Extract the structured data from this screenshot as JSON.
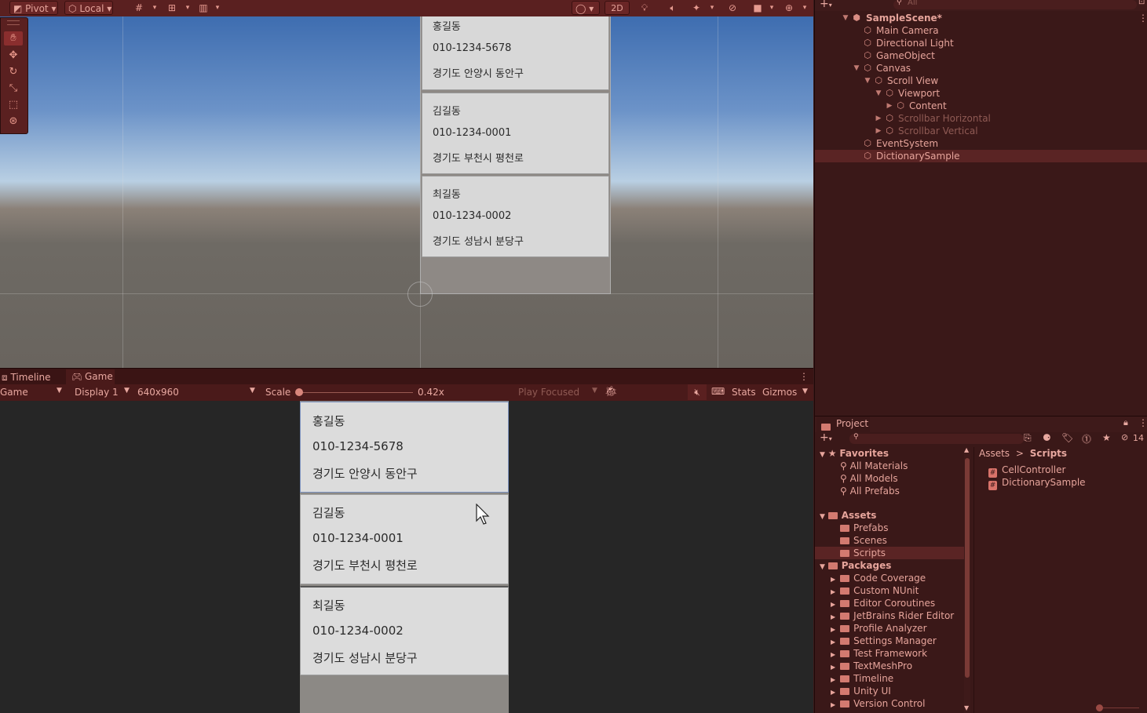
{
  "scene_toolbar": {
    "pivot_label": "Pivot",
    "local_label": "Local",
    "mode_2d_label": "2D"
  },
  "scene_cards": [
    {
      "name": "홍길동",
      "phone": "010-1234-5678",
      "address": "경기도 안양시 동안구"
    },
    {
      "name": "김길동",
      "phone": "010-1234-0001",
      "address": "경기도 부천시 평천로"
    },
    {
      "name": "최길동",
      "phone": "010-1234-0002",
      "address": "경기도 성남시 분당구"
    }
  ],
  "game_tabs": {
    "timeline_label": "Timeline",
    "game_label": "Game"
  },
  "game_toolbar": {
    "view_select": "Game",
    "display_select": "Display 1",
    "resolution_select": "640x960",
    "scale_label": "Scale",
    "scale_value_text": "0.42x",
    "play_focused_label": "Play Focused",
    "stats_label": "Stats",
    "gizmos_label": "Gizmos"
  },
  "game_cards": [
    {
      "name": "홍길동",
      "phone": "010-1234-5678",
      "address": "경기도 안양시 동안구"
    },
    {
      "name": "김길동",
      "phone": "010-1234-0001",
      "address": "경기도 부천시 평천로"
    },
    {
      "name": "최길동",
      "phone": "010-1234-0002",
      "address": "경기도 성남시 분당구"
    }
  ],
  "hierarchy": {
    "search_placeholder": "All",
    "scene_name": "SampleScene*",
    "items": [
      "Main Camera",
      "Directional Light",
      "GameObject",
      "Canvas",
      "Scroll View",
      "Viewport",
      "Content",
      "Scrollbar Horizontal",
      "Scrollbar Vertical",
      "EventSystem",
      "DictionarySample"
    ]
  },
  "project": {
    "tab_label": "Project",
    "hidden_count": "14",
    "breadcrumb_root": "Assets",
    "breadcrumb_sep": ">",
    "breadcrumb_current": "Scripts",
    "favorites_label": "Favorites",
    "favorites": [
      "All Materials",
      "All Models",
      "All Prefabs"
    ],
    "assets_label": "Assets",
    "asset_folders": [
      "Prefabs",
      "Scenes",
      "Scripts"
    ],
    "packages_label": "Packages",
    "packages": [
      "Code Coverage",
      "Custom NUnit",
      "Editor Coroutines",
      "JetBrains Rider Editor",
      "Profile Analyzer",
      "Settings Manager",
      "Test Framework",
      "TextMeshPro",
      "Timeline",
      "Unity UI",
      "Version Control"
    ],
    "files": [
      "CellController",
      "DictionarySample"
    ]
  }
}
